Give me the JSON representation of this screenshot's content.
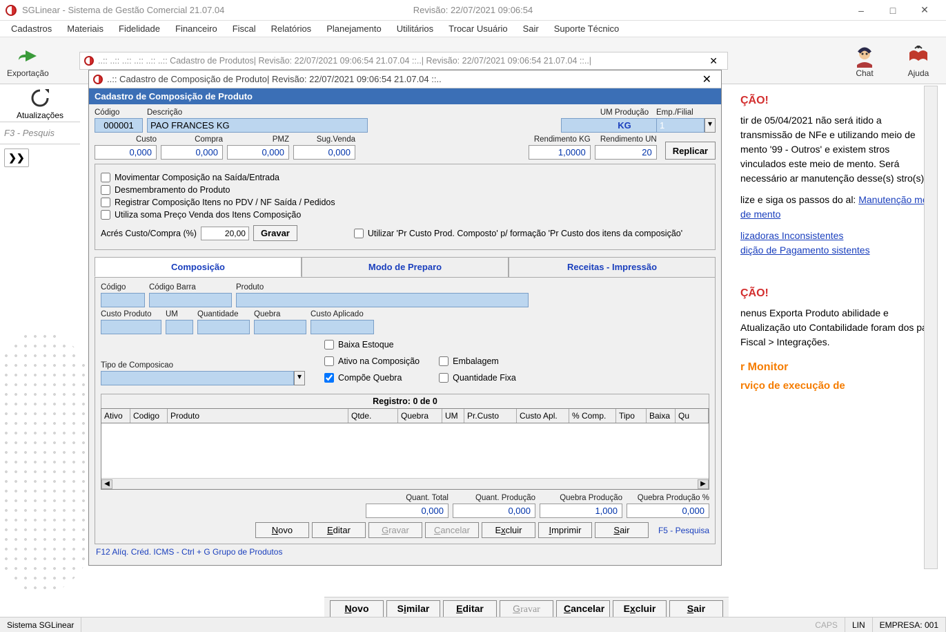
{
  "titlebar": {
    "app": "SGLinear - Sistema de Gestão Comercial 21.07.04",
    "rev": "Revisão: 22/07/2021 09:06:54"
  },
  "menubar": [
    "Cadastros",
    "Materiais",
    "Fidelidade",
    "Financeiro",
    "Fiscal",
    "Relatórios",
    "Planejamento",
    "Utilitários",
    "Trocar Usuário",
    "Sair",
    "Suporte Técnico"
  ],
  "toolbar": {
    "export": "Exportação",
    "update": "Atualizações",
    "chat": "Chat",
    "help": "Ajuda"
  },
  "left": {
    "search_hint": "F3 - Pesquis"
  },
  "cad_prod_title": "..:: ..:: ..:: ..:: ..:: ..:: Cadastro de Produtos| Revisão: 22/07/2021 09:06:54  21.07.04 ::..| Revisão: 22/07/2021 09:06:54  21.07.04 ::..| ",
  "composition_title": "..:: Cadastro de Composição de Produto| Revisão: 22/07/2021 09:06:54  21.07.04 ::..",
  "blue_header": "Cadastro de Composição de Produto",
  "form": {
    "codigo_lbl": "Código",
    "codigo": "000001",
    "descricao_lbl": "Descrição",
    "descricao": "PAO FRANCES KG",
    "um_lbl": "UM Produção",
    "um": "KG",
    "emp_lbl": "Emp./Filial",
    "emp": "1",
    "custo_lbl": "Custo",
    "custo": "0,000",
    "compra_lbl": "Compra",
    "compra": "0,000",
    "pmz_lbl": "PMZ",
    "pmz": "0,000",
    "sug_lbl": "Sug.Venda",
    "sug": "0,000",
    "rend_kg_lbl": "Rendimento KG",
    "rend_kg": "1,0000",
    "rend_un_lbl": "Rendimento UN",
    "rend_un": "20",
    "replicar": "Replicar"
  },
  "checks": {
    "c1": "Movimentar Composição na Saída/Entrada",
    "c2": "Desmembramento do Produto",
    "c3": "Registrar Composição Itens no PDV / NF Saída / Pedidos",
    "c4": "Utiliza soma Preço Venda dos Itens Composição",
    "acres_lbl": "Acrés Custo/Compra (%)",
    "acres_val": "20,00",
    "gravar": "Gravar",
    "c5": "Utilizar 'Pr Custo Prod. Composto' p/ formação 'Pr Custo dos itens da composição'"
  },
  "tabs": {
    "t1": "Composição",
    "t2": "Modo de Preparo",
    "t3": "Receitas - Impressão"
  },
  "comp_fields": {
    "codigo": "Código",
    "cod_barra": "Código Barra",
    "produto": "Produto",
    "custo_prod": "Custo Produto",
    "um": "UM",
    "qtd": "Quantidade",
    "quebra": "Quebra",
    "custo_apl": "Custo Aplicado",
    "tipo": "Tipo de Composicao",
    "baixa": "Baixa Estoque",
    "ativo": "Ativo na Composição",
    "compoe": "Compõe Quebra",
    "emb": "Embalagem",
    "qfixa": "Quantidade Fixa"
  },
  "grid": {
    "reg": "Registro: 0 de 0",
    "cols": [
      "Ativo",
      "Codigo",
      "Produto",
      "Qtde.",
      "Quebra",
      "UM",
      "Pr.Custo",
      "Custo Apl.",
      "% Comp.",
      "Tipo",
      "Baixa",
      "Qu"
    ]
  },
  "totals": {
    "qt": "Quant. Total",
    "qt_v": "0,000",
    "qp": "Quant. Produção",
    "qp_v": "0,000",
    "qb": "Quebra Produção",
    "qb_v": "1,000",
    "qbp": "Quebra Produção %",
    "qbp_v": "0,000"
  },
  "inner_buttons": {
    "novo": "Novo",
    "editar": "Editar",
    "gravar": "Gravar",
    "cancelar": "Cancelar",
    "excluir": "Excluir",
    "imprimir": "Imprimir",
    "sair": "Sair",
    "f5": "F5 - Pesquisa"
  },
  "footer_hint": "F12 Alíq. Créd. ICMS - Ctrl + G  Grupo de Produtos",
  "parent_buttons": {
    "novo": "Novo",
    "similar": "Similar",
    "editar": "Editar",
    "gravar": "Gravar",
    "cancelar": "Cancelar",
    "excluir": "Excluir",
    "sair": "Sair"
  },
  "side": {
    "h1": "ÇÃO!",
    "p1": "tir de 05/04/2021 não será itido a transmissão de NFe e  utilizando meio de mento '99 - Outros' e existem stros vinculados este meio de mento. Será necessário ar manutenção desse(s) stro(s).",
    "p2a": "lize e siga os passos do al: ",
    "link1": "Manutenção meio de mento",
    "link2": "lizadoras Inconsistentes",
    "link3": "dição de Pagamento sistentes",
    "h2": "ÇÃO!",
    "p3": "nenus Exporta Produto abilidade e Atualização uto Contabilidade foram dos para Fiscal > Integrações.",
    "hm": "r Monitor",
    "p4": "rviço de execução de"
  },
  "statusbar": {
    "left": "Sistema SGLinear",
    "caps": "CAPS",
    "lin": "LIN",
    "emp": "EMPRESA: 001"
  }
}
